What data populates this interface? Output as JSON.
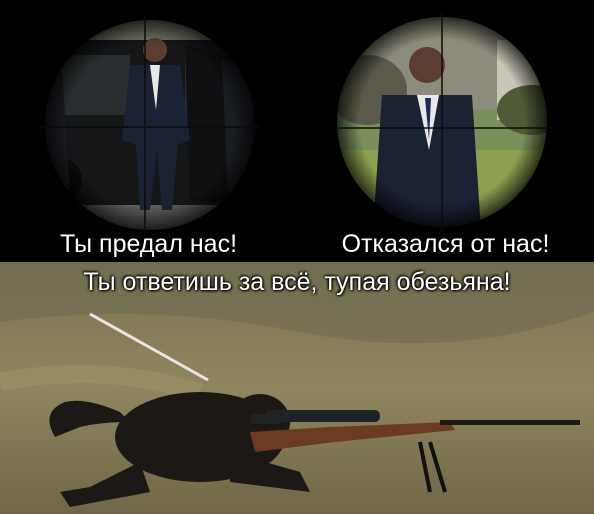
{
  "captions": {
    "top_left": "Ты предал нас!",
    "top_right": "Отказался от нас!",
    "bottom": "Ты ответишь за всё, тупая обезьяна!"
  },
  "colors": {
    "background": "#000000",
    "caption_text": "#ffffff",
    "grass": "#8a7f55",
    "suit": "#1b2233",
    "animal_fur": "#1c1816"
  }
}
